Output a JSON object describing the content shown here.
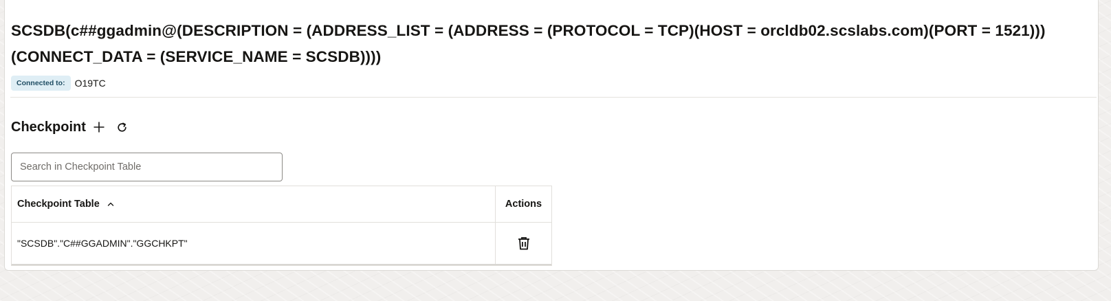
{
  "connection": {
    "title": "SCSDB(c##ggadmin@(DESCRIPTION = (ADDRESS_LIST = (ADDRESS = (PROTOCOL = TCP)(HOST = orcldb02.scslabs.com)(PORT = 1521))) (CONNECT_DATA = (SERVICE_NAME = SCSDB))))",
    "connected_to_label": "Connected to:",
    "connected_to_value": "O19TC"
  },
  "checkpoint": {
    "section_title": "Checkpoint",
    "add_icon": "plus-icon",
    "refresh_icon": "refresh-icon",
    "search": {
      "placeholder": "Search in Checkpoint Table",
      "value": ""
    },
    "table": {
      "columns": [
        "Checkpoint Table",
        "Actions"
      ],
      "sort": "ascending",
      "rows": [
        {
          "name": "\"SCSDB\".\"C##GGADMIN\".\"GGCHKPT\"",
          "action_icon": "trash-icon"
        }
      ]
    }
  },
  "colors": {
    "badge_bg": "#dfeef5",
    "badge_text": "#1f4d63",
    "page_bg": "#f1efed",
    "card_bg": "#ffffff"
  }
}
